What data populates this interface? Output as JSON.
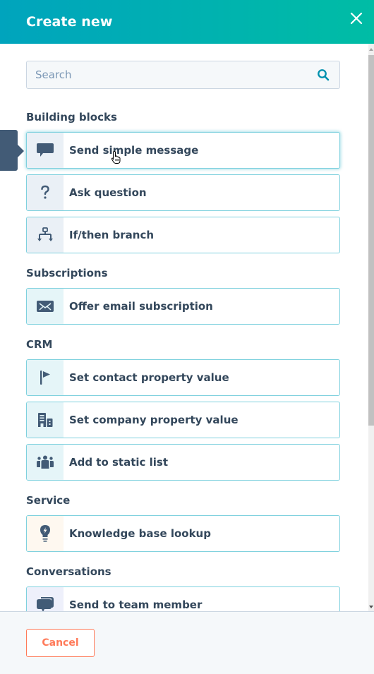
{
  "header": {
    "title": "Create new",
    "close_icon": "close-icon"
  },
  "search": {
    "placeholder": "Search",
    "value": "",
    "icon": "search-icon"
  },
  "sections": [
    {
      "label": "Building blocks",
      "items": [
        {
          "label": "Send simple message",
          "icon": "chat-bubble-icon",
          "state": "hover"
        },
        {
          "label": "Ask question",
          "icon": "question-mark-icon"
        },
        {
          "label": "If/then branch",
          "icon": "branch-icon"
        }
      ]
    },
    {
      "label": "Subscriptions",
      "items": [
        {
          "label": "Offer email subscription",
          "icon": "envelope-icon"
        }
      ]
    },
    {
      "label": "CRM",
      "items": [
        {
          "label": "Set contact property value",
          "icon": "flag-icon"
        },
        {
          "label": "Set company property value",
          "icon": "building-icon"
        },
        {
          "label": "Add to static list",
          "icon": "people-group-icon"
        }
      ]
    },
    {
      "label": "Service",
      "items": [
        {
          "label": "Knowledge base lookup",
          "icon": "lightbulb-icon"
        }
      ]
    },
    {
      "label": "Conversations",
      "items": [
        {
          "label": "Send to team member",
          "icon": "chat-bubbles-icon"
        }
      ]
    }
  ],
  "footer": {
    "cancel_label": "Cancel"
  },
  "colors": {
    "header_gradient_start": "#00a4bd",
    "header_gradient_end": "#00bda5",
    "card_border": "#7fd1de",
    "text": "#33475b",
    "icon": "#425b76",
    "cancel": "#ff7a59"
  }
}
